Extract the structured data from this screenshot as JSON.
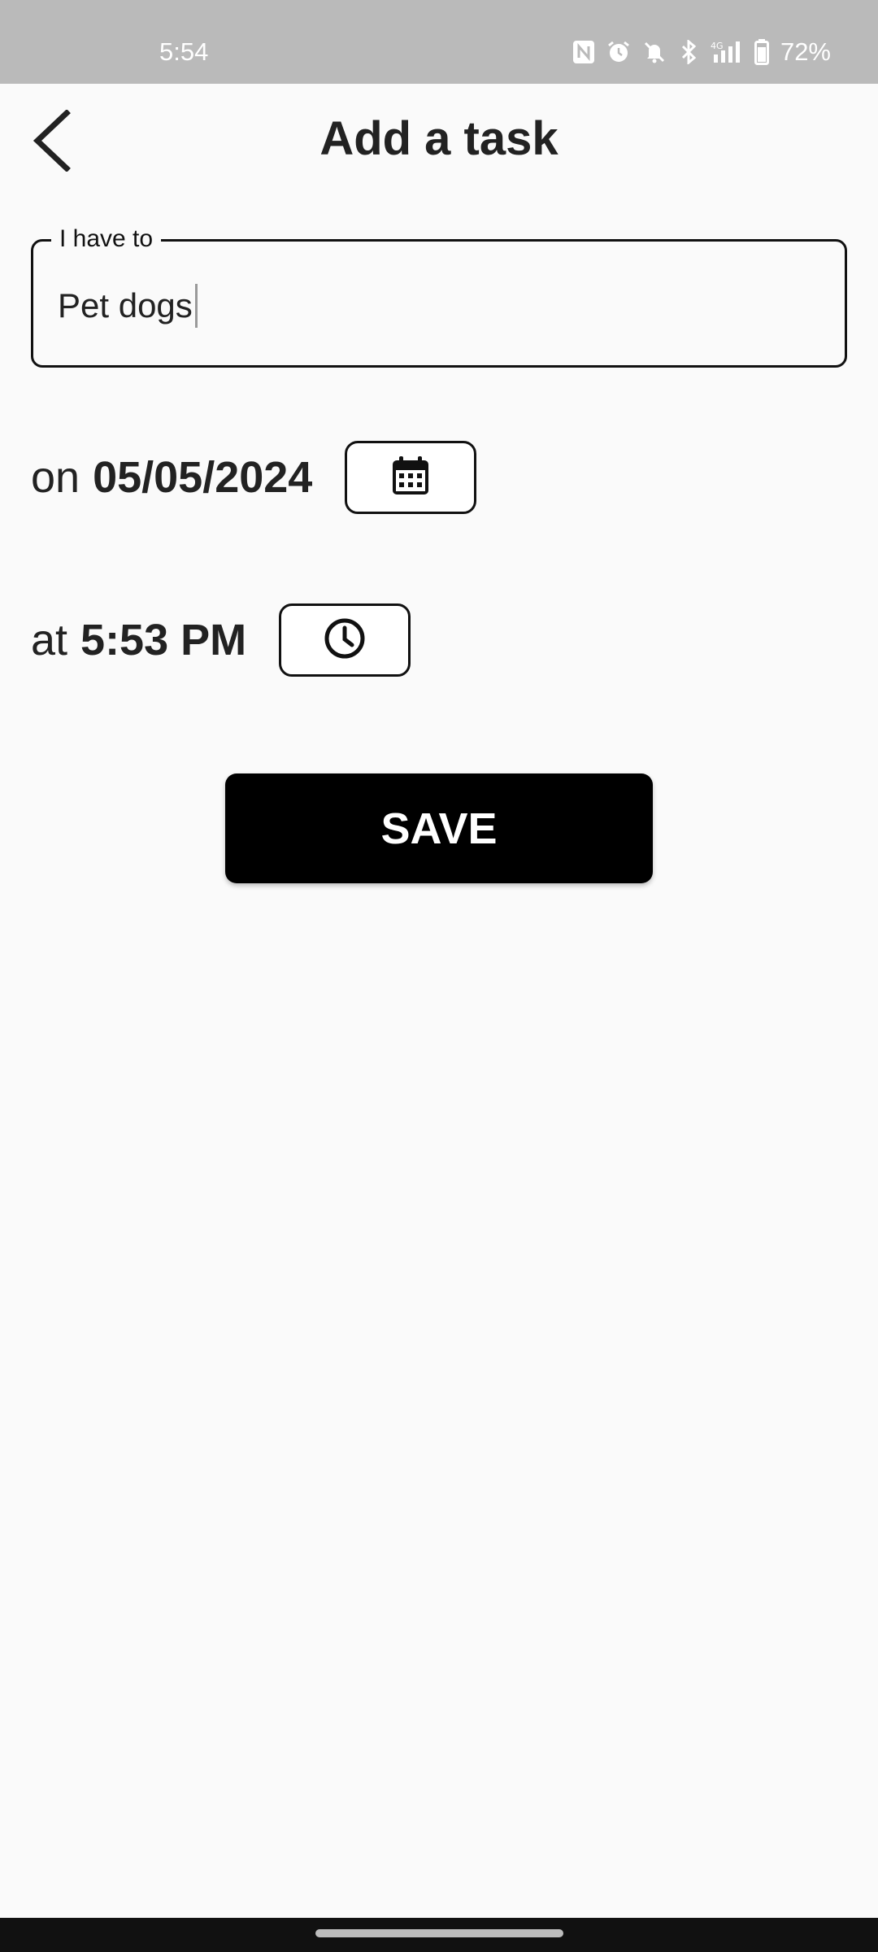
{
  "status_bar": {
    "time": "5:54",
    "battery": "72%",
    "icons": [
      "nfc-icon",
      "alarm-icon",
      "mute-icon",
      "bluetooth-icon",
      "signal-4g-icon",
      "battery-icon"
    ]
  },
  "app_bar": {
    "title": "Add a task",
    "back_icon": "chevron-left-icon"
  },
  "task_field": {
    "label": "I have to",
    "value": "Pet dogs"
  },
  "date_row": {
    "prefix": "on",
    "value": "05/05/2024",
    "button_icon": "calendar-icon"
  },
  "time_row": {
    "prefix": "at",
    "value": "5:53 PM",
    "button_icon": "clock-icon"
  },
  "save_button": {
    "label": "SAVE"
  },
  "colors": {
    "status_bar_bg": "#bababa",
    "page_bg": "#fafafa",
    "primary": "#000000",
    "nav_bar_bg": "#111111"
  }
}
